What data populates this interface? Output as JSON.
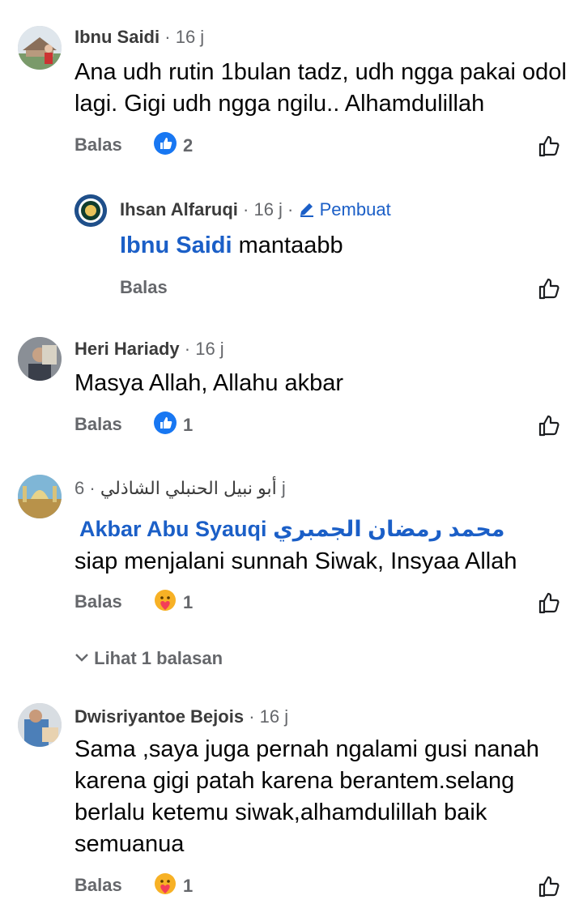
{
  "comments": [
    {
      "author": "Ibnu Saidi",
      "time": "16 j",
      "text": "Ana udh rutin 1bulan tadz, udh ngga pakai odol lagi. Gigi udh ngga ngilu.. Alhamdulillah",
      "reply_label": "Balas",
      "reaction_icon": "like-icon",
      "reaction_count": "2"
    },
    {
      "author": "Ihsan Alfaruqi",
      "time": "16 j",
      "badge": "Pembuat",
      "mention": "Ibnu Saidi",
      "text": "mantaabb",
      "reply_label": "Balas"
    },
    {
      "author": "Heri Hariady",
      "time": "16 j",
      "text": "Masya Allah, Allahu akbar",
      "reply_label": "Balas",
      "reaction_icon": "like-icon",
      "reaction_count": "1"
    },
    {
      "author": "أبو نبيل الحنبلي الشاذلي",
      "time": "6 j",
      "mention": "Akbar Abu Syauqi",
      "mention_arabic": "محمد رمضان الجمبري",
      "text": "siap menjalani sunnah Siwak, Insyaa Allah",
      "reply_label": "Balas",
      "reaction_icon": "care-icon",
      "reaction_count": "1",
      "view_replies": "Lihat 1 balasan"
    },
    {
      "author": "Dwisriyantoe Bejois",
      "time": "16 j",
      "text": "Sama ,saya juga pernah ngalami gusi nanah karena gigi patah karena berantem.selang berlalu ketemu siwak,alhamdulillah baik semuanua",
      "reply_label": "Balas",
      "reaction_icon": "care-icon",
      "reaction_count": "1"
    }
  ],
  "colors": {
    "like_blue": "#1877f2",
    "mention_blue": "#1b5fc7",
    "meta_gray": "#65676b"
  }
}
